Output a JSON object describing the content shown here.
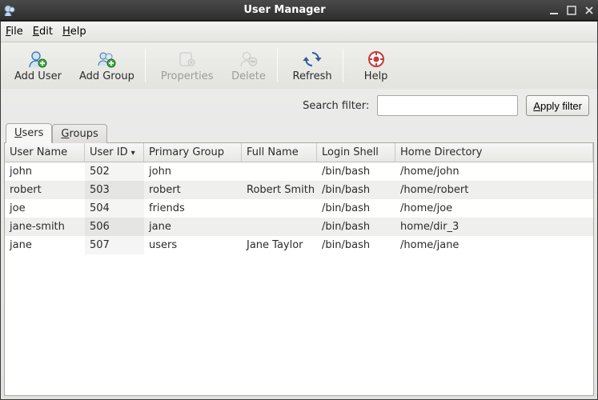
{
  "window": {
    "title": "User Manager"
  },
  "menu": {
    "file": "File",
    "edit": "Edit",
    "help": "Help"
  },
  "toolbar": {
    "add_user": "Add User",
    "add_group": "Add Group",
    "properties": "Properties",
    "delete": "Delete",
    "refresh": "Refresh",
    "help": "Help"
  },
  "search": {
    "label": "Search filter:",
    "value": "",
    "apply": "Apply filter"
  },
  "tabs": {
    "users": "Users",
    "groups": "Groups"
  },
  "columns": {
    "user_name": "User Name",
    "user_id": "User ID",
    "primary_group": "Primary Group",
    "full_name": "Full Name",
    "login_shell": "Login Shell",
    "home_dir": "Home Directory"
  },
  "rows": [
    {
      "user_name": "john",
      "user_id": "502",
      "primary_group": "john",
      "full_name": "",
      "login_shell": "/bin/bash",
      "home_dir": "/home/john"
    },
    {
      "user_name": "robert",
      "user_id": "503",
      "primary_group": "robert",
      "full_name": "Robert Smith",
      "login_shell": "/bin/bash",
      "home_dir": "/home/robert"
    },
    {
      "user_name": "joe",
      "user_id": "504",
      "primary_group": "friends",
      "full_name": "",
      "login_shell": "/bin/bash",
      "home_dir": "/home/joe"
    },
    {
      "user_name": "jane-smith",
      "user_id": "506",
      "primary_group": "jane",
      "full_name": "",
      "login_shell": "/bin/bash",
      "home_dir": "home/dir_3"
    },
    {
      "user_name": "jane",
      "user_id": "507",
      "primary_group": "users",
      "full_name": "Jane Taylor",
      "login_shell": "/bin/bash",
      "home_dir": "/home/jane"
    }
  ]
}
